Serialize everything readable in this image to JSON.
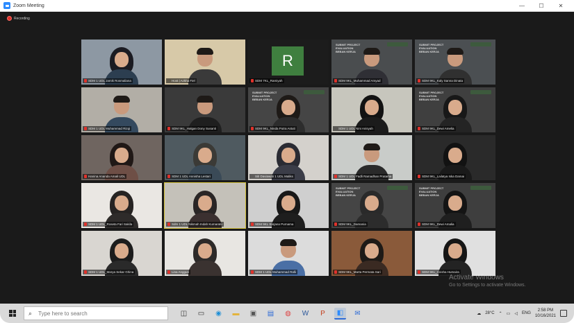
{
  "window": {
    "title": "Zoom Meeting"
  },
  "recording": {
    "label": "Recording"
  },
  "participants": [
    {
      "name": "SDM 1 UDL Jamik Rosmaliana",
      "bg": "#8d98a3",
      "type": "hijab",
      "veil": "#1b1b22",
      "body": "#2c3e50",
      "muted": true
    },
    {
      "name": "Host | Azkha Fiel",
      "bg": "#d7c9a8",
      "type": "man",
      "veil": "#1e1a17",
      "body": "#3a3a3a",
      "muted": false
    },
    {
      "name": "SDM 7KL_Ramiyah",
      "bg": "#1c1c1c",
      "type": "avatar",
      "avatar": "R",
      "muted": true
    },
    {
      "name": "SDM 9KL_Muhammad Arsyad",
      "bg": "#4a4d4f",
      "type": "man",
      "veil": "#1e1a17",
      "body": "#2f2f35",
      "muted": true,
      "overlay": true
    },
    {
      "name": "SDM 9KL_Kaly Sanna Dinata",
      "bg": "#4b4f52",
      "type": "man",
      "veil": "#1e1a17",
      "body": "#303030",
      "muted": true,
      "overlay": true
    },
    {
      "name": "SDM 1 UDL Muhammad Rizqi",
      "bg": "#b2aea6",
      "type": "man",
      "veil": "#1e1a17",
      "body": "#34495e",
      "muted": true
    },
    {
      "name": "SDM 9KL_Halgan Dony Susanti",
      "bg": "#3a3a3a",
      "type": "man",
      "veil": "#1e1a17",
      "body": "#1f1f1f",
      "muted": true
    },
    {
      "name": "SDM 9KL_Ninda Putra Astuti",
      "bg": "#454545",
      "type": "hijab",
      "veil": "#1e1a17",
      "body": "#2d2d2d",
      "muted": true,
      "overlay": true
    },
    {
      "name": "SDM 1 UDL Nini Anisyah",
      "bg": "#c7c6bd",
      "type": "hijab",
      "veil": "#121212",
      "body": "#1b1b1b",
      "muted": false
    },
    {
      "name": "SDM 9KL_Dewi Amelia",
      "bg": "#3f3f3f",
      "type": "hijab",
      "veil": "#181818",
      "body": "#242424",
      "muted": true,
      "overlay": true
    },
    {
      "name": "Hanina Ananda Amali UDL",
      "bg": "#6f6560",
      "type": "hijab",
      "veil": "#201816",
      "body": "#6e4f46",
      "muted": true
    },
    {
      "name": "SDM 1 UDL Annisha Lestari",
      "bg": "#4f5a60",
      "type": "hijab",
      "veil": "#3b3a36",
      "body": "#3a4a57",
      "muted": true
    },
    {
      "name": "Siti Daviawati 1 UDL Maliks",
      "bg": "#d4d1cc",
      "type": "hijab",
      "veil": "#2a2b33",
      "body": "#3b3d48",
      "muted": false
    },
    {
      "name": "SDM 1 UDL Fadli Ramadhan Pratama",
      "bg": "#c9ccc9",
      "type": "man",
      "veil": "#1e1a17",
      "body": "#2a2a2a",
      "muted": true
    },
    {
      "name": "SDM 9KL_Lailatya Iska Damai",
      "bg": "#2a2a2a",
      "type": "hijab",
      "veil": "#121212",
      "body": "#1a1a1a",
      "muted": true
    },
    {
      "name": "SDM 1 UDL_Roseta Fari Sakila",
      "bg": "#eae7e3",
      "type": "hijab",
      "veil": "#262322",
      "body": "#2e2b2a",
      "muted": true
    },
    {
      "name": "Sdm 1 UDL Nikmah Indah Kumaratu",
      "bg": "#c4c1b9",
      "type": "hijab",
      "veil": "#2a2626",
      "body": "#3b3030",
      "muted": true,
      "active": true
    },
    {
      "name": "SDM 9KL Sarjana Purnama",
      "bg": "#cfcfcf",
      "type": "hijab",
      "veil": "#181818",
      "body": "#1e1e1e",
      "muted": true
    },
    {
      "name": "SDM 9KL_Damania",
      "bg": "#454545",
      "type": "hijab",
      "veil": "#2a2a2a",
      "body": "#2c2c2c",
      "muted": true,
      "overlay": true
    },
    {
      "name": "SDM 9KL_Dewi Amalia",
      "bg": "#3e3e3e",
      "type": "hijab",
      "veil": "#141414",
      "body": "#1f1f1f",
      "muted": true,
      "overlay": true
    },
    {
      "name": "SDM 1 UDL_Marya Sekar Ghina",
      "bg": "#d9d6d1",
      "type": "hijab",
      "veil": "#1c1c1c",
      "body": "#2a2a2a",
      "muted": true
    },
    {
      "name": "Lina Anggun",
      "bg": "#e8e6e2",
      "type": "hijab",
      "veil": "#2d2a29",
      "body": "#3a3230",
      "muted": true
    },
    {
      "name": "SDM 1 UDL Muhammad Rafii",
      "bg": "#dcdcdc",
      "type": "man",
      "veil": "#1e1a17",
      "body": "#4a6fa5",
      "muted": true
    },
    {
      "name": "SDM 9KL_Marta Permata Sari",
      "bg": "#8a5a3a",
      "type": "hijab",
      "veil": "#1e1a17",
      "body": "#3a2a22",
      "muted": true
    },
    {
      "name": "SDM 9KL_Anisha Humaira",
      "bg": "#e0e0e0",
      "type": "hijab",
      "veil": "#161616",
      "body": "#232323",
      "muted": true
    }
  ],
  "overlay_text": {
    "line1": "SUBMIT PROJECT",
    "line2": "EVALUATION",
    "line3": "BEBAN KERJA"
  },
  "watermark": {
    "line1": "Activate Windows",
    "line2": "Go to Settings to activate Windows."
  },
  "taskbar": {
    "search_placeholder": "Type here to search",
    "icons": [
      "task-view-icon",
      "file-explorer-icon",
      "edge-icon",
      "folder-icon",
      "store-icon",
      "photos-icon",
      "chrome-icon",
      "word-icon",
      "powerpoint-icon",
      "zoom-icon",
      "mail-icon"
    ],
    "temperature": "28°C",
    "language": "ENG",
    "time": "2:58 PM",
    "date": "10/16/2021"
  }
}
